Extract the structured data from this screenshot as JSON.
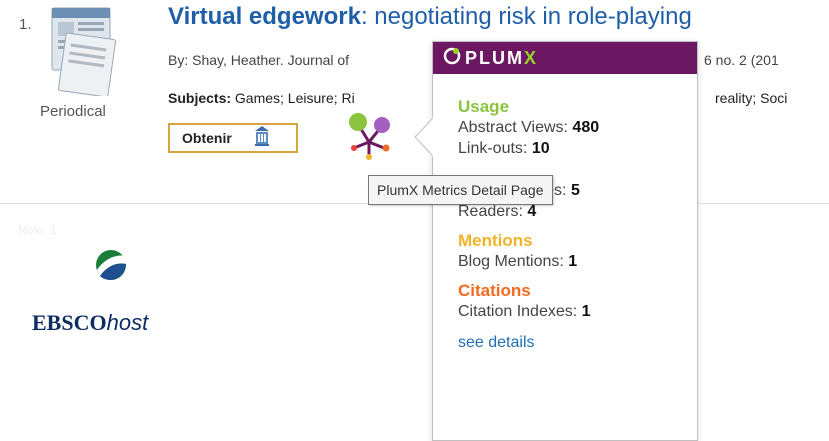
{
  "result": {
    "number": "1.",
    "pub_type": "Periodical",
    "title_bold": "Virtual edgework",
    "title_rest": ": negotiating risk in role-playing",
    "byline": "By: Shay, Heather. Journal of",
    "byline_tail": "6 no. 2 (201",
    "subjects_label": "Subjects:",
    "subjects_value": " Games; Leisure; Ri",
    "subjects_tail": "reality; Soci",
    "obtenir_label": "Obtenir"
  },
  "brand": {
    "ebsco_bold": "EBSCO",
    "ebsco_italic": "host",
    "faint_label": "Note: 1"
  },
  "tooltip": {
    "text": "PlumX Metrics Detail Page"
  },
  "plumx": {
    "logo_text": "PLUM",
    "logo_x": "X",
    "usage": {
      "heading": "Usage",
      "abstract_views_label": "Abstract Views: ",
      "abstract_views_value": "480",
      "linkouts_label": "Link-outs: ",
      "linkouts_value": "10",
      "exports_label": "Exports-Saves: ",
      "exports_value": "5",
      "readers_label": "Readers: ",
      "readers_value": "4"
    },
    "mentions": {
      "heading": "Mentions",
      "blog_label": "Blog Mentions: ",
      "blog_value": "1"
    },
    "citations": {
      "heading": "Citations",
      "indexes_label": "Citation Indexes: ",
      "indexes_value": "1"
    },
    "see_details": "see details"
  },
  "colors": {
    "header_purple": "#6b1761",
    "usage_green": "#8ac43f",
    "mentions_yellow": "#f0b429",
    "citations_orange": "#f26b21",
    "link_blue": "#1f5fa8"
  }
}
